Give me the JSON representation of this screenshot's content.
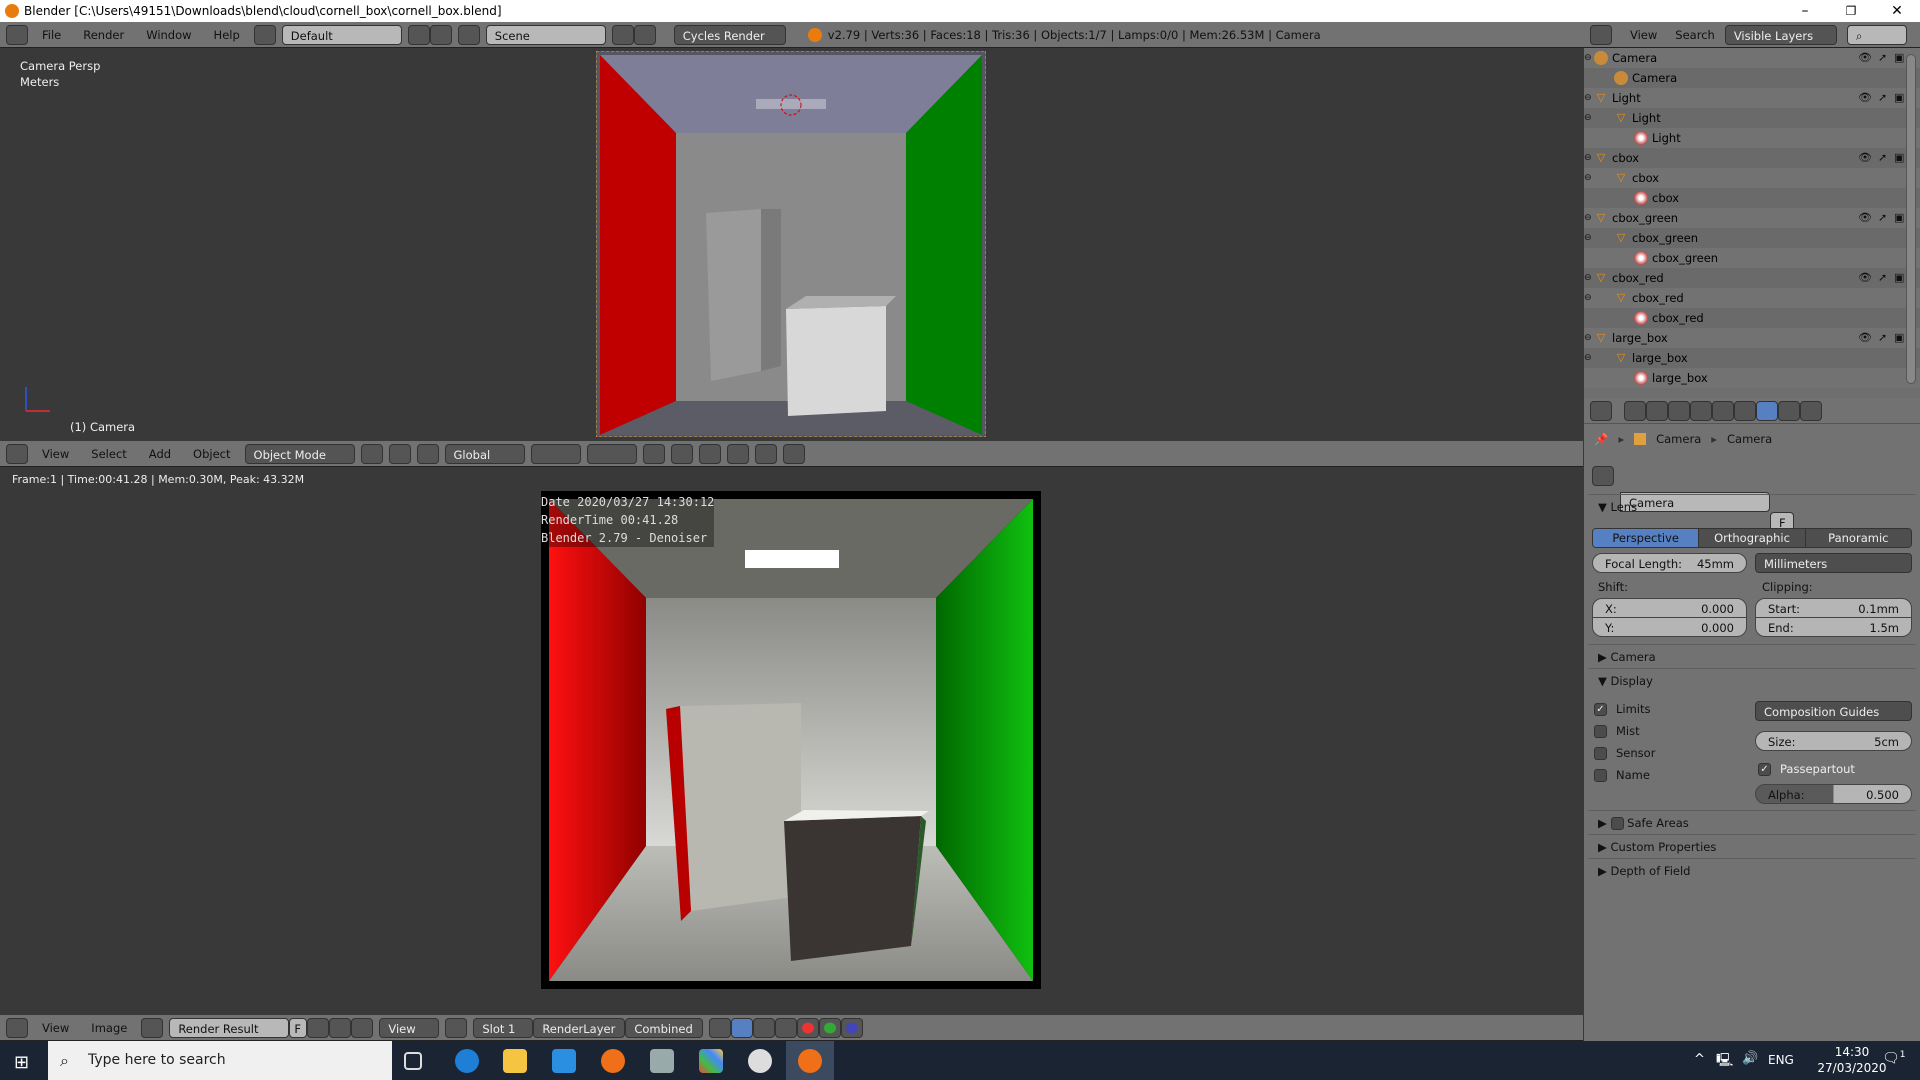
{
  "window": {
    "title": "Blender [C:\\Users\\49151\\Downloads\\blend\\cloud\\cornell_box\\cornell_box.blend]",
    "minimize": "–",
    "maximize": "❐",
    "close": "✕"
  },
  "info_header": {
    "menus": [
      "File",
      "Render",
      "Window",
      "Help"
    ],
    "layout": "Default",
    "scene": "Scene",
    "engine": "Cycles Render",
    "stats": "v2.79 | Verts:36 | Faces:18 | Tris:36 | Objects:1/7 | Lamps:0/0 | Mem:26.53M | Camera"
  },
  "viewport": {
    "view_name": "Camera Persp",
    "units": "Meters",
    "object_label": "(1) Camera"
  },
  "viewport_header": {
    "menus": [
      "View",
      "Select",
      "Add",
      "Object"
    ],
    "mode": "Object Mode",
    "orientation": "Global"
  },
  "image_editor": {
    "status": "Frame:1 | Time:00:41.28 | Mem:0.30M, Peak: 43.32M",
    "stamp": [
      "Date 2020/03/27 14:30:12",
      "RenderTime 00:41.28",
      "Blender 2.79 - Denoiser"
    ]
  },
  "image_header": {
    "menus": [
      "View",
      "Image"
    ],
    "image": "Render Result",
    "fake_user": "F",
    "view": "View",
    "slot": "Slot 1",
    "layer": "RenderLayer",
    "pass": "Combined"
  },
  "outliner": {
    "menus": [
      "View",
      "Search"
    ],
    "filter": "Visible Layers",
    "rows": [
      {
        "label": "Camera",
        "level": 0,
        "icon": "camera-object-icon",
        "vis": true
      },
      {
        "label": "Camera",
        "level": 1,
        "icon": "camera-data-icon",
        "vis": false
      },
      {
        "label": "Light",
        "level": 0,
        "icon": "mesh-object-icon",
        "vis": true
      },
      {
        "label": "Light",
        "level": 1,
        "icon": "mesh-data-icon",
        "vis": false
      },
      {
        "label": "Light",
        "level": 2,
        "icon": "material-icon",
        "vis": false
      },
      {
        "label": "cbox",
        "level": 0,
        "icon": "mesh-object-icon",
        "vis": true
      },
      {
        "label": "cbox",
        "level": 1,
        "icon": "mesh-data-icon",
        "vis": false
      },
      {
        "label": "cbox",
        "level": 2,
        "icon": "material-icon",
        "vis": false
      },
      {
        "label": "cbox_green",
        "level": 0,
        "icon": "mesh-object-icon",
        "vis": true
      },
      {
        "label": "cbox_green",
        "level": 1,
        "icon": "mesh-data-icon",
        "vis": false
      },
      {
        "label": "cbox_green",
        "level": 2,
        "icon": "material-icon",
        "vis": false
      },
      {
        "label": "cbox_red",
        "level": 0,
        "icon": "mesh-object-icon",
        "vis": true
      },
      {
        "label": "cbox_red",
        "level": 1,
        "icon": "mesh-data-icon",
        "vis": false
      },
      {
        "label": "cbox_red",
        "level": 2,
        "icon": "material-icon",
        "vis": false
      },
      {
        "label": "large_box",
        "level": 0,
        "icon": "mesh-object-icon",
        "vis": true
      },
      {
        "label": "large_box",
        "level": 1,
        "icon": "mesh-data-icon",
        "vis": false
      },
      {
        "label": "large_box",
        "level": 2,
        "icon": "material-icon",
        "vis": false
      }
    ]
  },
  "properties": {
    "breadcrumb": [
      "Camera",
      "Camera"
    ],
    "datablock": "Camera",
    "fake_user": "F",
    "lens": {
      "title": "Lens",
      "types": [
        "Perspective",
        "Orthographic",
        "Panoramic"
      ],
      "active_type": "Perspective",
      "focal_label": "Focal Length:",
      "focal_value": "45mm",
      "units": "Millimeters",
      "shift_label": "Shift:",
      "clip_label": "Clipping:",
      "shift_x_label": "X:",
      "shift_x": "0.000",
      "shift_y_label": "Y:",
      "shift_y": "0.000",
      "clip_start_label": "Start:",
      "clip_start": "0.1mm",
      "clip_end_label": "End:",
      "clip_end": "1.5m"
    },
    "camera_panel": "Camera",
    "display": {
      "title": "Display",
      "limits": "Limits",
      "mist": "Mist",
      "sensor": "Sensor",
      "name": "Name",
      "limits_checked": true,
      "mist_checked": false,
      "sensor_checked": false,
      "name_checked": false,
      "guides": "Composition Guides",
      "size_label": "Size:",
      "size": "5cm",
      "passepartout": "Passepartout",
      "passepartout_checked": true,
      "alpha_label": "Alpha:",
      "alpha": "0.500",
      "alpha_fraction": 0.5
    },
    "safe_areas": "Safe Areas",
    "custom_props": "Custom Properties",
    "dof": "Depth of Field"
  },
  "taskbar": {
    "search_placeholder": "Type here to search",
    "lang": "ENG",
    "time": "14:30",
    "date": "27/03/2020",
    "notifications": "1"
  },
  "colors": {
    "accent": "#5680c2",
    "header": "#727272",
    "viewport": "#393939",
    "taskbar": "#1a2433"
  }
}
